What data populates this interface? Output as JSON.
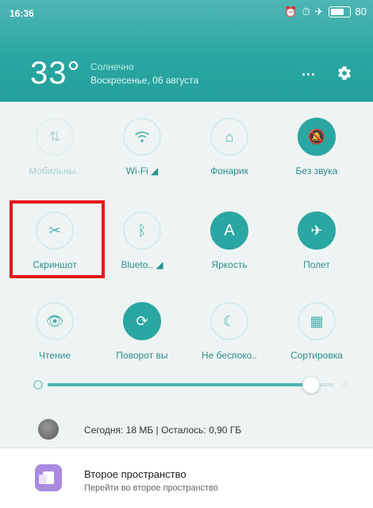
{
  "status": {
    "time": "16:36",
    "battery_text": "80"
  },
  "weather": {
    "temp": "33°",
    "condition": "Солнечно",
    "date": "Воскресенье, 06 августа"
  },
  "header": {
    "more_label": "···"
  },
  "tiles": [
    {
      "label": "Мобильны..",
      "state": "disabled",
      "icon": "sort-arrows-icon"
    },
    {
      "label": "Wi-Fi ◢",
      "state": "off",
      "icon": "wifi-icon"
    },
    {
      "label": "Фонарик",
      "state": "off",
      "icon": "flashlight-icon"
    },
    {
      "label": "Без звука",
      "state": "on",
      "icon": "bell-off-icon"
    },
    {
      "label": "Скриншот",
      "state": "off",
      "icon": "scissors-icon"
    },
    {
      "label": "Blueto.. ◢",
      "state": "off",
      "icon": "bluetooth-icon"
    },
    {
      "label": "Яркость",
      "state": "on",
      "icon": "brightness-a-icon"
    },
    {
      "label": "Полет",
      "state": "on",
      "icon": "airplane-icon"
    },
    {
      "label": "Чтение",
      "state": "off",
      "icon": "eye-icon"
    },
    {
      "label": "Поворот вы",
      "state": "on",
      "icon": "rotation-lock-icon"
    },
    {
      "label": "Не беспоко..",
      "state": "off",
      "icon": "moon-icon"
    },
    {
      "label": "Сортировка",
      "state": "off",
      "icon": "grid-icon"
    }
  ],
  "brightness": {
    "level": 0.92
  },
  "data_usage": {
    "text": "Сегодня: 18 МБ | Осталось: 0,90 ГБ"
  },
  "second_space": {
    "title": "Второе пространство",
    "subtitle": "Перейти во второе пространство"
  }
}
